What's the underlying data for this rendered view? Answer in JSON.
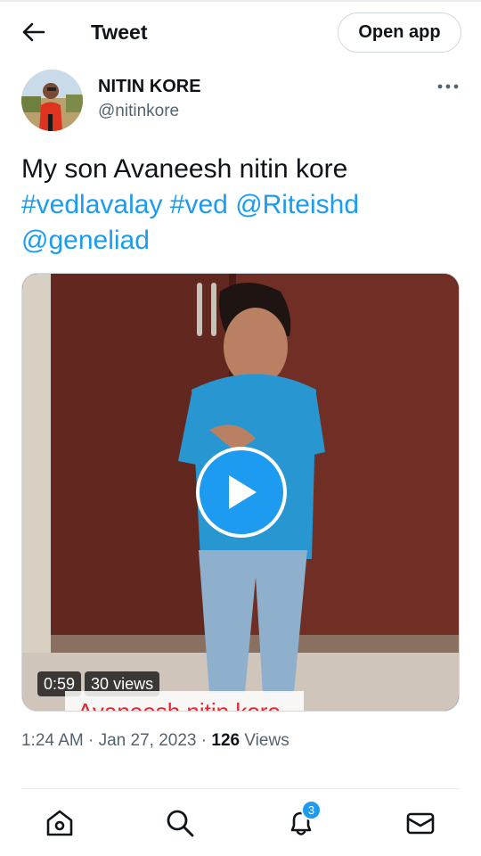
{
  "header": {
    "title": "Tweet",
    "open_app_label": "Open app"
  },
  "author": {
    "name": "NITIN KORE",
    "handle": "@nitinkore"
  },
  "tweet": {
    "text_plain": "My son Avaneesh nitin kore",
    "hashtag_1": "#vedlavalay",
    "hashtag_2": "#ved",
    "mention_1": "@Riteishd",
    "mention_2": "@geneliad"
  },
  "media": {
    "duration": "0:59",
    "views": "30 views",
    "overlay_caption": "Avaneesh nitin kore"
  },
  "meta": {
    "time": "1:24 AM",
    "separator_1": " · ",
    "date": "Jan 27, 2023",
    "separator_2": " · ",
    "view_count": "126",
    "views_label": " Views"
  },
  "nav": {
    "notifications_count": "3",
    "items": [
      "home-icon",
      "search-icon",
      "bell-icon",
      "mail-icon"
    ]
  },
  "colors": {
    "accent": "#1d9bf0",
    "text": "#0f1419",
    "muted": "#536471"
  }
}
